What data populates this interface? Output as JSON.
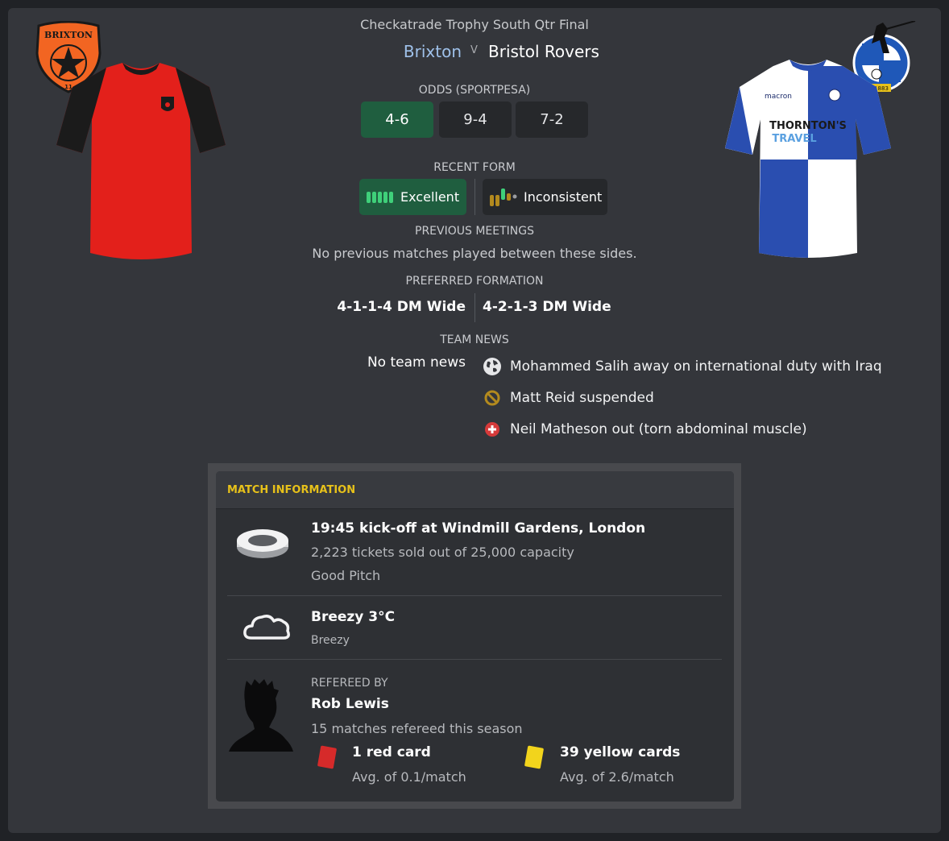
{
  "match": {
    "competition": "Checkatrade Trophy South Qtr Final",
    "home_team": "Brixton",
    "vs": "V",
    "away_team": "Bristol Rovers"
  },
  "odds": {
    "label": "ODDS (SPORTPESA)",
    "home": "4-6",
    "draw": "9-4",
    "away": "7-2"
  },
  "form": {
    "label": "RECENT FORM",
    "home": "Excellent",
    "away": "Inconsistent"
  },
  "meetings": {
    "label": "PREVIOUS MEETINGS",
    "text": "No previous matches played between these sides."
  },
  "formation": {
    "label": "PREFERRED FORMATION",
    "home": "4-1-1-4 DM Wide",
    "away": "4-2-1-3 DM Wide"
  },
  "team_news": {
    "label": "TEAM NEWS",
    "home": "No team news",
    "away": [
      {
        "icon": "globe-icon",
        "text": "Mohammed Salih away on international duty with Iraq"
      },
      {
        "icon": "suspended-icon",
        "text": "Matt Reid suspended"
      },
      {
        "icon": "injury-icon",
        "text": "Neil Matheson out (torn abdominal muscle)"
      }
    ]
  },
  "badges": {
    "home_text": "BRIXTON",
    "home_sub": "11",
    "away_ring": "BRISTOL ROVERS FC",
    "away_year": "1883"
  },
  "kits": {
    "away_sponsor_1": "THORNTON'S",
    "away_sponsor_2": "TRAVEL",
    "away_maker": "macron"
  },
  "match_info": {
    "header": "MATCH INFORMATION",
    "venue": {
      "title": "19:45 kick-off at Windmill Gardens, London",
      "tickets": "2,223 tickets sold out of 25,000 capacity",
      "pitch": "Good Pitch"
    },
    "weather": {
      "title": "Breezy 3°C",
      "sub": "Breezy"
    },
    "referee": {
      "label": "REFEREED BY",
      "name": "Rob Lewis",
      "matches": "15 matches refereed this season",
      "red_cards": "1 red card",
      "red_avg": "Avg. of 0.1/match",
      "yellow_cards": "39 yellow cards",
      "yellow_avg": "Avg. of 2.6/match"
    }
  },
  "colors": {
    "panel": "#34363b",
    "favourite_green": "#1f5e3f",
    "home_name": "#9fc1ea",
    "header_yellow": "#e7c11a",
    "home_kit_red": "#e3201b",
    "away_kit_blue": "#2a4eb0"
  }
}
